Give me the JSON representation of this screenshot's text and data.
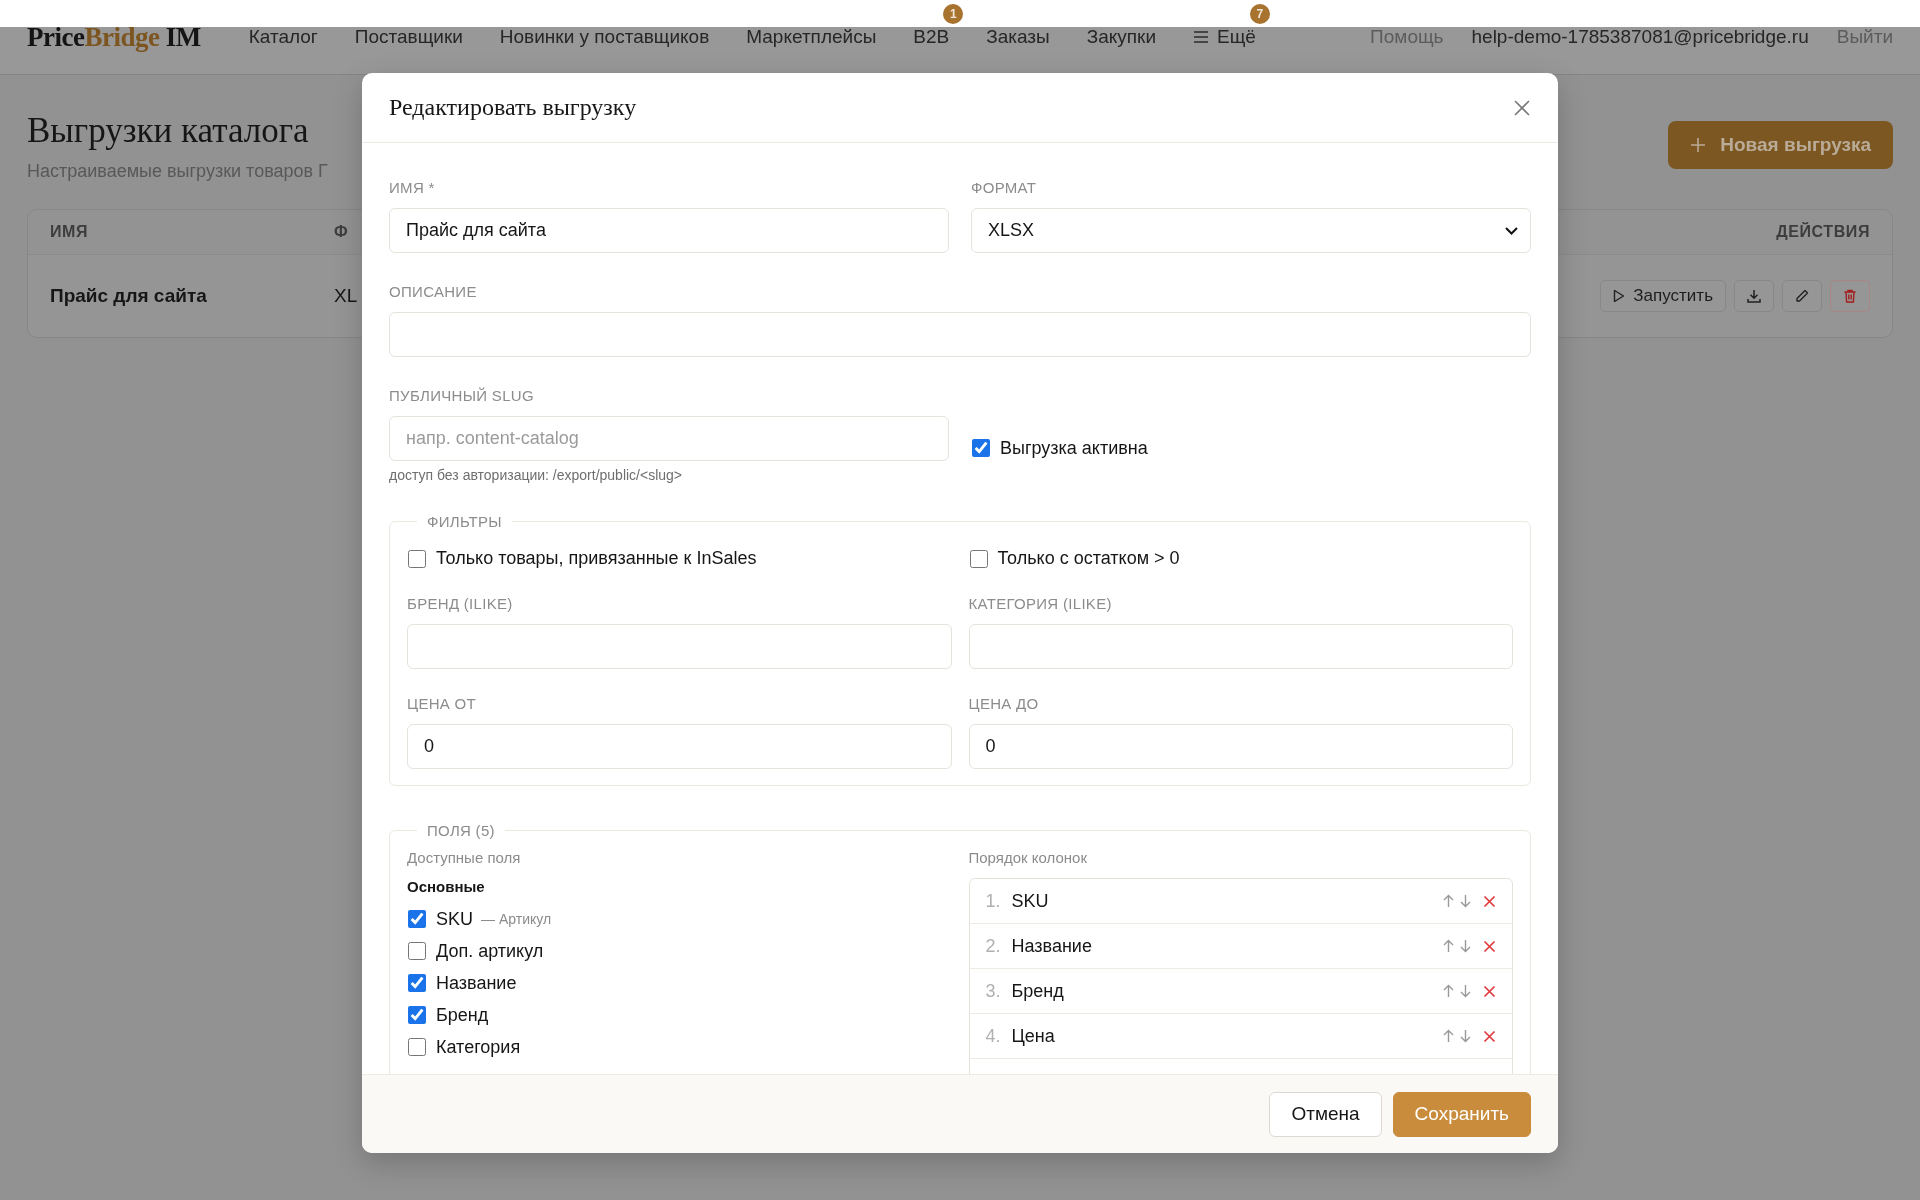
{
  "nav": {
    "logo": [
      {
        "text": "Price",
        "accent": false
      },
      {
        "text": "Bridge",
        "accent": true
      },
      {
        "text": " IM",
        "accent": false
      }
    ],
    "items": [
      {
        "label": "Каталог"
      },
      {
        "label": "Поставщики"
      },
      {
        "label": "Новинки у поставщиков"
      },
      {
        "label": "Маркетплейсы"
      },
      {
        "label": "B2B",
        "badge": "1"
      },
      {
        "label": "Заказы"
      },
      {
        "label": "Закупки"
      },
      {
        "label": "Ещё",
        "kind": "menu",
        "badge": "7"
      }
    ],
    "help": "Помощь",
    "user": "help-demo-1785387081@pricebridge.ru",
    "logout": "Выйти"
  },
  "page": {
    "title": "Выгрузки каталога",
    "subtitle": "Настраиваемые выгрузки товаров Г",
    "new_button": "Новая выгрузка",
    "table": {
      "columns": [
        "ИМЯ",
        "Ф",
        "ДЕЙСТВИЯ"
      ],
      "rows": [
        {
          "cells": [
            "Прайс для сайта",
            "XL"
          ],
          "run_label": "Запустить"
        }
      ]
    }
  },
  "modal": {
    "title": "Редактировать выгрузку",
    "name": {
      "label": "ИМЯ *",
      "value": "Прайс для сайта"
    },
    "format": {
      "label": "ФОРМАТ",
      "value": "XLSX"
    },
    "description": {
      "label": "ОПИСАНИЕ"
    },
    "slug": {
      "label": "ПУБЛИЧНЫЙ SLUG",
      "placeholder": "напр. content-catalog",
      "hint": "доступ без авторизации: /export/public/<slug>"
    },
    "active": {
      "label": "Выгрузка активна",
      "checked": true
    },
    "filters": {
      "legend": "ФИЛЬТРЫ",
      "checks": [
        {
          "label": "Только товары, привязанные к InSales",
          "checked": false
        },
        {
          "label": "Только с остатком > 0",
          "checked": false
        }
      ],
      "inputs": [
        {
          "label": "БРЕНД (ILIKE)"
        },
        {
          "label": "КАТЕГОРИЯ (ILIKE)"
        },
        {
          "label": "ЦЕНА ОТ",
          "value": "0"
        },
        {
          "label": "ЦЕНА ДО",
          "value": "0"
        }
      ]
    },
    "fields": {
      "legend": "ПОЛЯ (5)",
      "available_title": "Доступные поля",
      "group": "Основные",
      "options": [
        {
          "label": "SKU",
          "note": "— Артикул",
          "checked": true
        },
        {
          "label": "Доп. артикул",
          "checked": false
        },
        {
          "label": "Название",
          "checked": true
        },
        {
          "label": "Бренд",
          "checked": true
        },
        {
          "label": "Категория",
          "checked": false
        }
      ],
      "order_title": "Порядок колонок",
      "order": [
        {
          "number": "1.",
          "label": "SKU"
        },
        {
          "number": "2.",
          "label": "Название"
        },
        {
          "number": "3.",
          "label": "Бренд"
        },
        {
          "number": "4.",
          "label": "Цена"
        }
      ]
    },
    "cancel": "Отмена",
    "save": "Сохранить"
  }
}
